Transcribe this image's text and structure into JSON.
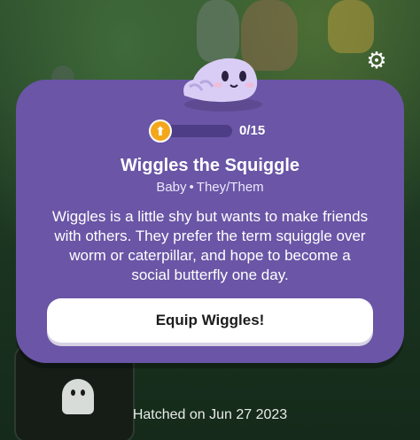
{
  "header": {
    "settings_icon": "gear-icon"
  },
  "pet": {
    "name": "Wiggles the Squiggle",
    "stage": "Baby",
    "separator": "•",
    "pronouns": "They/Them",
    "description": "Wiggles is a little shy but wants to make friends with others. They prefer the term squiggle over worm or caterpillar, and hope to become a social butterfly one day.",
    "color": "#d9cdf5"
  },
  "progress": {
    "label": "0/15",
    "value": 0,
    "max": 15,
    "fill_fraction": 0.1,
    "badge_icon": "level-up-arrow-icon",
    "badge_color": "#f4a71b"
  },
  "actions": {
    "equip_label": "Equip Wiggles!"
  },
  "footer": {
    "hatched_text": "Hatched on Jun 27 2023"
  },
  "theme": {
    "card_color": "#6a55a6",
    "button_color": "#ffffff"
  }
}
